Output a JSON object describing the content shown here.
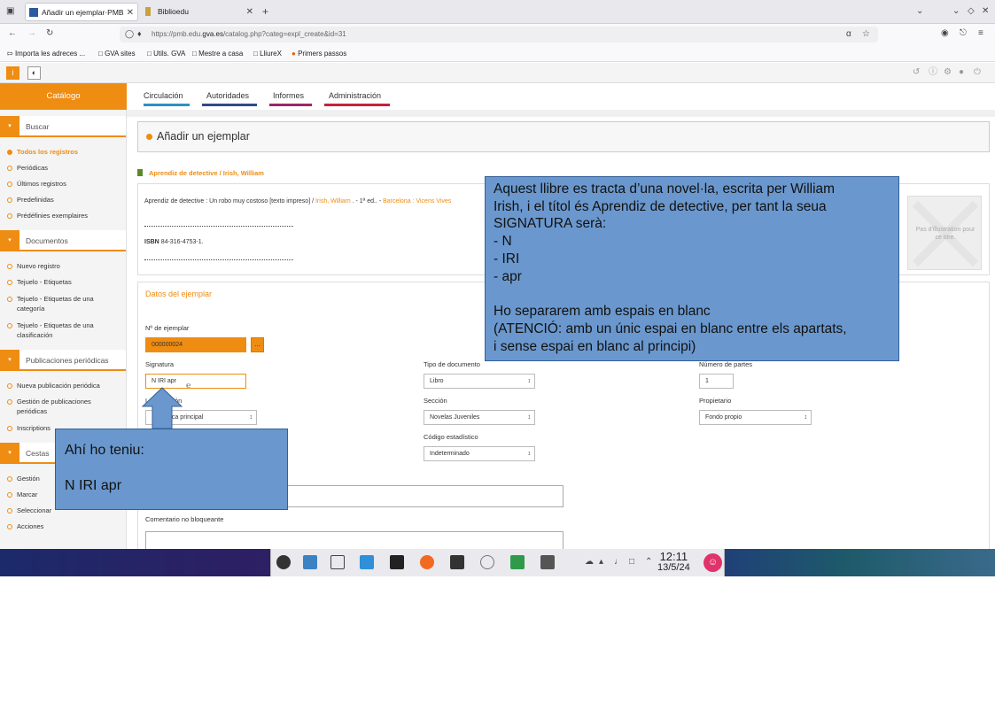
{
  "browser": {
    "tabs": [
      {
        "label": "Añadir un ejemplar·PMB",
        "active": true
      },
      {
        "label": "Biblioedu",
        "active": false
      }
    ],
    "url_prefix": "https://pmb.edu.",
    "url_domain": "gva.es",
    "url_path": "/catalog.php?categ=expl_create&id=31",
    "bookmarks": [
      "Importa les adreces ...",
      "GVA sites",
      "Utils. GVA",
      "Mestre a casa",
      "LliureX",
      "Primers passos"
    ]
  },
  "sidebar": {
    "header": "Catálogo",
    "sections": [
      {
        "title": "Buscar",
        "items": [
          "Todos los registros",
          "Periódicas",
          "Últimos registros",
          "Predefinidas",
          "Prédéfinies exemplaires"
        ]
      },
      {
        "title": "Documentos",
        "items": [
          "Nuevo registro",
          "Tejuelo - Etiquetas",
          "Tejuelo - Etiquetas de una categoría",
          "Tejuelo - Etiquetas de una clasificación"
        ]
      },
      {
        "title": "Publicaciones periódicas",
        "items": [
          "Nueva publicación periódica",
          "Gestión de publicaciones periódicas",
          "Inscriptions"
        ]
      },
      {
        "title": "Cestas",
        "items": [
          "Gestión",
          "Marcar",
          "Seleccionar",
          "Acciones"
        ]
      }
    ]
  },
  "main_tabs": [
    {
      "label": "Circulación",
      "color": "#2e8fc7"
    },
    {
      "label": "Autoridades",
      "color": "#2e4a8a"
    },
    {
      "label": "Informes",
      "color": "#a0246a"
    },
    {
      "label": "Administración",
      "color": "#c8203a"
    }
  ],
  "page_title": "Añadir un ejemplar",
  "record": {
    "title": "Aprendiz de detective / Irish, William",
    "line_main": "Aprendiz de detective : Un robo muy costoso [texto impreso] / ",
    "line_author": "Irish, William",
    "line_mid": " . - 1ª ed.. - ",
    "line_publisher": "Barcelona : Vicens Vives",
    "isbn_label": "ISBN",
    "isbn_value": "84-316-4753-1.",
    "no_image_text": "Pas d'illustration pour ce titre."
  },
  "form": {
    "section_title": "Datos del ejemplar",
    "nro_label": "Nº de ejemplar",
    "nro_value": "000000024",
    "dots_label": "...",
    "signatura_label": "Signatura",
    "signatura_value": "N IRI apr",
    "tipo_label": "Tipo de documento",
    "tipo_value": "Libro",
    "partes_label": "Número de partes",
    "partes_value": "1",
    "localizacion_label": "Localización",
    "localizacion_value": "Biblioteca principal",
    "seccion_label": "Sección",
    "seccion_value": "Novelas Juveniles",
    "propietario_label": "Propietario",
    "propietario_value": "Fondo propio",
    "codigo_label": "Código estadístico",
    "codigo_value": "Indeterminado",
    "comentario_label": "Comentario no bloqueante"
  },
  "callout_big": {
    "lines": [
      "Aquest llibre es tracta d’una novel·la, escrita per William",
      "Irish, i el títol és Aprendiz de detective, per tant la seua",
      "SIGNATURA serà:",
      "- N",
      "- IRI",
      "- apr",
      "",
      "Ho separarem amb espais en blanc",
      "(ATENCIÓ: amb un únic espai en blanc entre els apartats,",
      "i sense espai en blanc al principi)"
    ]
  },
  "callout_small": {
    "line1": "Ahí ho teniu:",
    "line2": "N IRI apr"
  },
  "taskbar": {
    "time": "12:11",
    "date": "13/5/24"
  }
}
